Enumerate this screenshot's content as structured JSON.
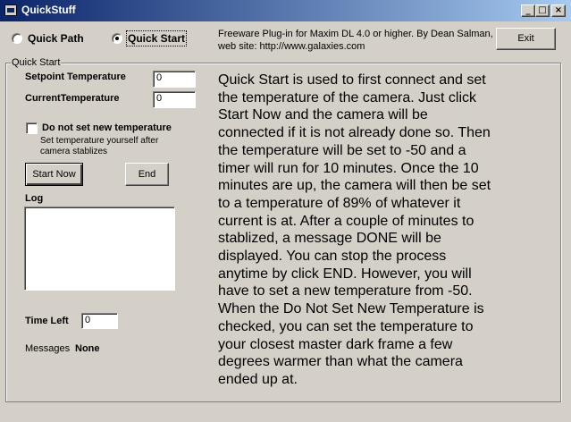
{
  "window": {
    "title": "QuickStuff",
    "minimize_glyph": "_",
    "maximize_glyph": "□",
    "close_glyph": "×",
    "title_gradient": [
      "#0a246a",
      "#a6caf0"
    ]
  },
  "modes": [
    {
      "label": "Quick Path",
      "selected": false
    },
    {
      "label": "Quick Start",
      "selected": true
    }
  ],
  "info": {
    "line1": "Freeware Plug-in for Maxim DL 4.0 or higher.  By Dean Salman,",
    "line2": "web site: http://www.galaxies.com"
  },
  "exit_label": "Exit",
  "group": {
    "title": "Quick Start",
    "setpoint_label": "Setpoint Temperature",
    "setpoint_value": "0",
    "current_label": "CurrentTemperature",
    "current_value": "0",
    "no_set_label": "Do not set new temperature",
    "no_set_checked": false,
    "no_set_hint_1": "Set temperature yourself after",
    "no_set_hint_2": "camera stablizes",
    "start_label": "Start Now",
    "end_label": "End",
    "log_label": "Log",
    "log_value": "",
    "time_left_label": "Time Left",
    "time_left_value": "0",
    "messages_label": "Messages",
    "messages_value": "None",
    "description": "Quick Start is used to first connect and set the temperature of the camera.  Just click Start Now and the camera will be connected if it is not already done so.  Then the temperature will be set to -50 and a timer will run for 10 minutes.  Once the 10 minutes are up, the camera will then be set to a temperature of 89% of whatever it current is at.  After a couple of minutes to stablized, a message DONE will be displayed.  You can stop the process anytime by click END.  However, you will have to set a new temperature from -50.  When the Do Not Set New Temperature is checked, you can set the temperature to your closest master dark frame a few degrees warmer than what the camera ended up at."
  }
}
